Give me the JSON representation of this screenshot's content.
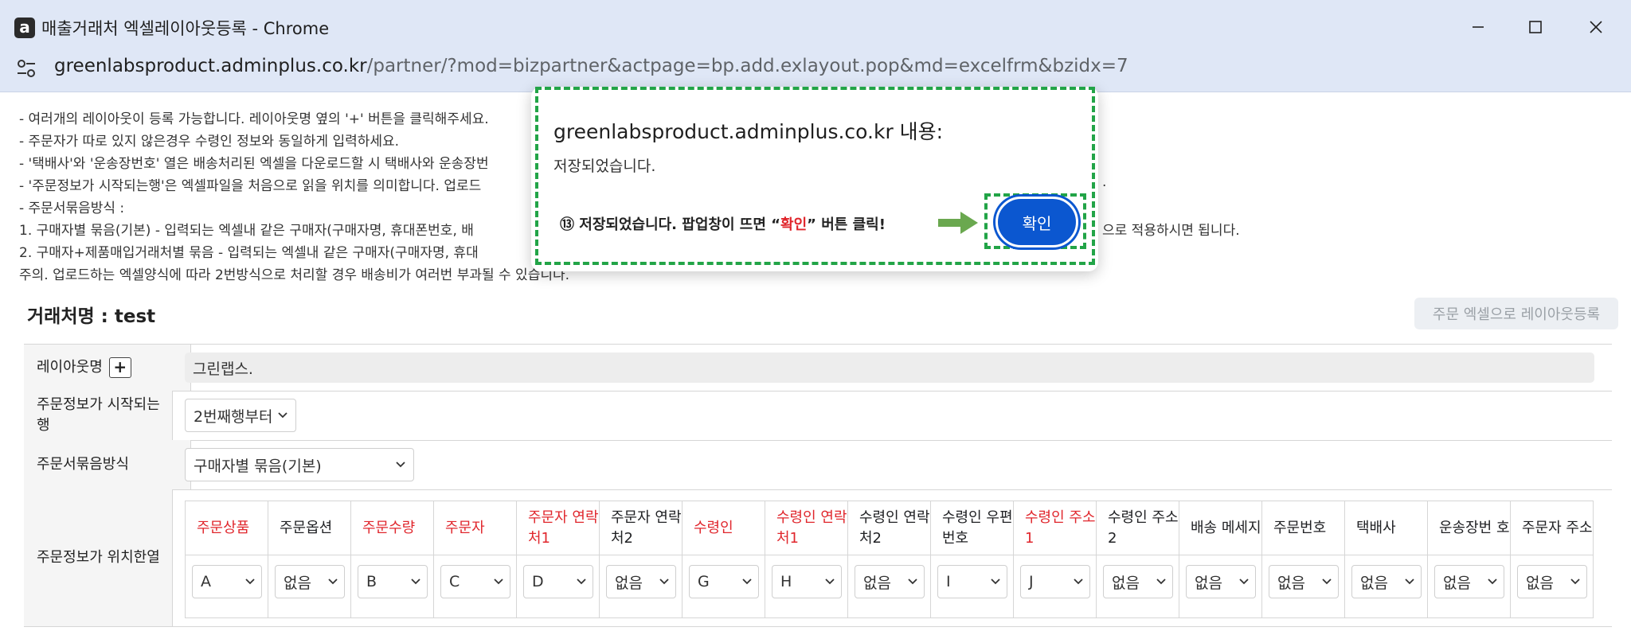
{
  "window": {
    "title": "매출거래처 엑셀레이아웃등록 - Chrome",
    "logo_letter": "a",
    "url_host": "greenlabsproduct.adminplus.co.kr",
    "url_path": "/partner/?mod=bizpartner&actpage=bp.add.exlayout.pop&md=excelfrm&bzidx=7"
  },
  "notes": [
    "- 여러개의 레이아웃이 등록 가능합니다. 레이아웃명 옆의 '+' 버튼을 클릭해주세요.",
    "- 주문자가 따로 있지 않은경우 수령인 정보와 동일하게 입력하세요.",
    "- '택배사'와 '운송장번호' 열은 배송처리된 엑셀을 다운로드할 시 택배사와 운송장번",
    "- '주문정보가 시작되는행'은 엑셀파일을 처음으로 읽을 위치를 의미합니다. 업로드",
    "- 주문서묶음방식 :",
    "   1. 구매자별 묶음(기본) - 입력되는 엑셀내 같은 구매자(구매자명, 휴대폰번호, 배",
    "   2. 구매자+제품매입거래처별 묶음 - 입력되는 엑셀내 같은 구매자(구매자명, 휴대",
    "   주의. 업로드하는 엑셀양식에 따라 2번방식으로 처리할 경우 배송비가 여러번 부과될 수 있습니다."
  ],
  "notes_right_fragments": [
    ".",
    "으로 적용하시면 됩니다."
  ],
  "partner": {
    "title": "거래처명 : test",
    "layout_button": "주문 엑셀으로 레이아웃등록"
  },
  "form": {
    "layout_name_label": "레이아웃명",
    "plus_symbol": "+",
    "layout_name_value": "그린랩스.",
    "start_row_label": "주문정보가 시작되는행",
    "start_row_value": "2번째행부터",
    "bundle_label": "주문서묶음방식",
    "bundle_value": "구매자별 묶음(기본)",
    "position_label": "주문정보가 위치한열",
    "columns": [
      {
        "header": "주문상품",
        "required": true,
        "value": "A"
      },
      {
        "header": "주문옵션",
        "required": false,
        "value": "없음"
      },
      {
        "header": "주문수량",
        "required": true,
        "value": "B"
      },
      {
        "header": "주문자",
        "required": true,
        "value": "C"
      },
      {
        "header": "주문자 연락처1",
        "required": true,
        "value": "D"
      },
      {
        "header": "주문자 연락처2",
        "required": false,
        "value": "없음"
      },
      {
        "header": "수령인",
        "required": true,
        "value": "G"
      },
      {
        "header": "수령인 연락처1",
        "required": true,
        "value": "H"
      },
      {
        "header": "수령인 연락처2",
        "required": false,
        "value": "없음"
      },
      {
        "header": "수령인 우편번호",
        "required": false,
        "value": "I"
      },
      {
        "header": "수령인 주소1",
        "required": true,
        "value": "J"
      },
      {
        "header": "수령인 주소2",
        "required": false,
        "value": "없음"
      },
      {
        "header": "배송 메세지",
        "required": false,
        "value": "없음"
      },
      {
        "header": "주문번호",
        "required": false,
        "value": "없음"
      },
      {
        "header": "택배사",
        "required": false,
        "value": "없음"
      },
      {
        "header": "운송장번 호",
        "required": false,
        "value": "없음"
      },
      {
        "header": "주문자 주소",
        "required": false,
        "value": "없음"
      }
    ]
  },
  "dialog": {
    "title": "greenlabsproduct.adminplus.co.kr 내용:",
    "message": "저장되었습니다.",
    "instruction_prefix": "⑬ 저장되었습니다. 팝업창이 뜨면 “",
    "instruction_highlight": "확인",
    "instruction_suffix": "” 버튼 클릭!",
    "ok_label": "확인"
  },
  "colors": {
    "accent_blue": "#0b57d0",
    "required_red": "#e0262c",
    "highlight_green": "#22a447",
    "arrow_green": "#6aa84f",
    "titlebar": "#dfe7f6"
  }
}
